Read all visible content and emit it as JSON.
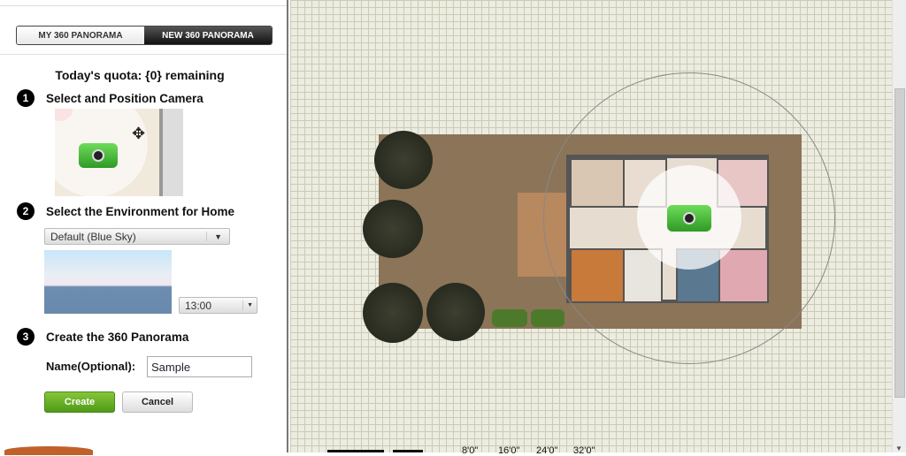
{
  "tabs": {
    "my": "MY 360 PANORAMA",
    "new": "NEW 360 PANORAMA"
  },
  "quota": "Today's quota: {0} remaining",
  "steps": [
    {
      "num": "1",
      "title": "Select and Position Camera"
    },
    {
      "num": "2",
      "title": "Select the Environment for Home"
    },
    {
      "num": "3",
      "title": "Create the 360 Panorama"
    }
  ],
  "environment": {
    "selected": "Default (Blue Sky)",
    "time": "13:00"
  },
  "name_label": "Name(Optional):",
  "name_value": "Sample",
  "buttons": {
    "create": "Create",
    "cancel": "Cancel"
  },
  "ruler": [
    "8'0\"",
    "16'0\"",
    "24'0\"",
    "32'0\""
  ],
  "icons": {
    "move": "move-icon",
    "camera": "camera-icon",
    "dropdown": "chevron-down-icon"
  }
}
